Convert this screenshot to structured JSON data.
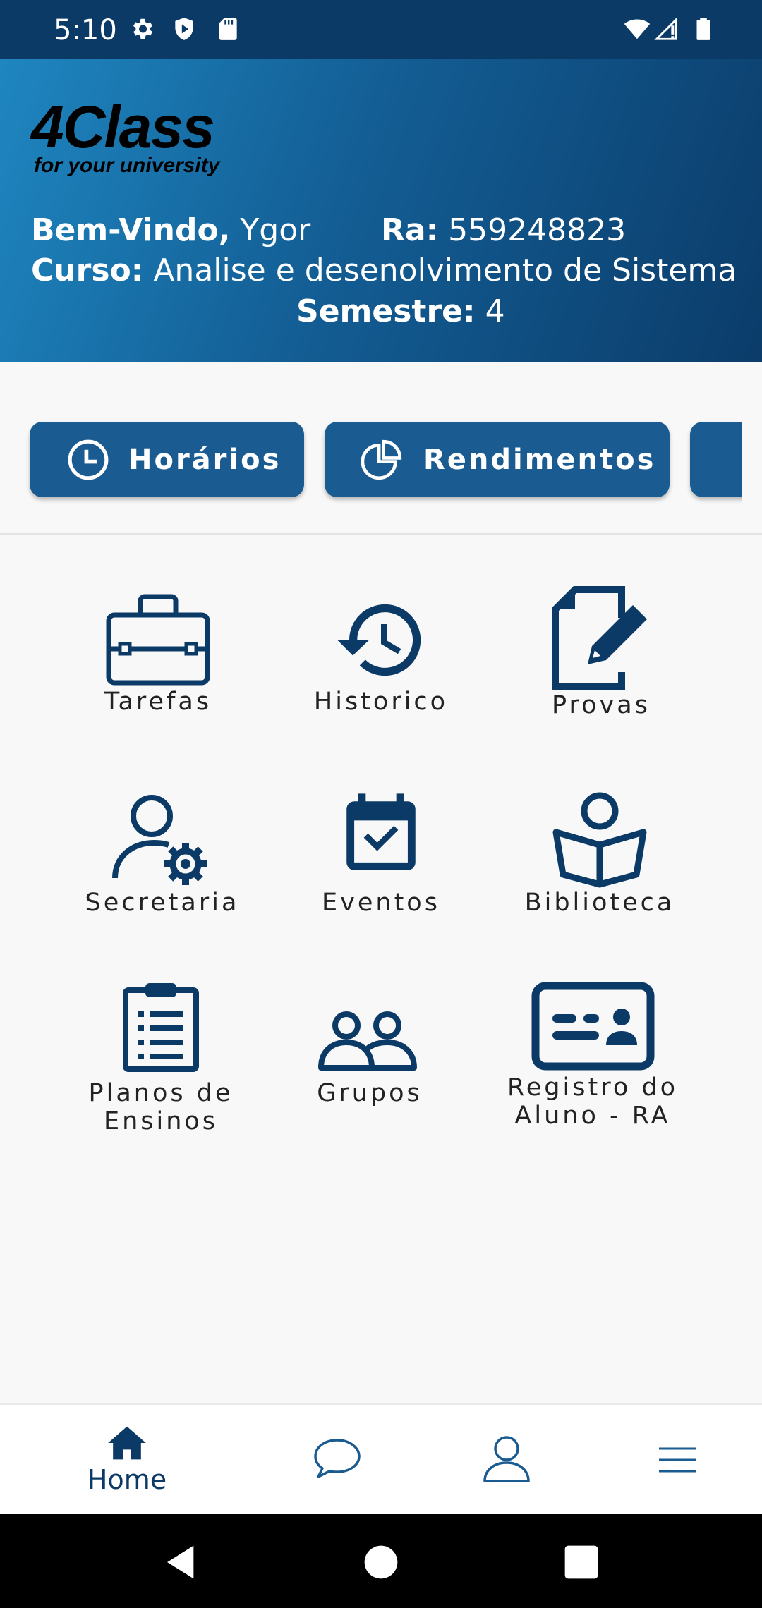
{
  "status_bar": {
    "time": "5:10",
    "icons": [
      "gear-icon",
      "shield-icon",
      "sd-card-icon",
      "wifi-icon",
      "signal-icon",
      "battery-icon"
    ]
  },
  "header": {
    "logo_main": "4Class",
    "logo_sub": "for your university",
    "welcome_label": "Bem-Vindo,",
    "welcome_name": "Ygor",
    "ra_label": "Ra:",
    "ra_value": "559248823",
    "curso_label": "Curso:",
    "curso_value": "Analise e desenolvimento de Sistema",
    "semestre_label": "Semestre:",
    "semestre_value": "4"
  },
  "quick_buttons": [
    {
      "label": "Horários",
      "icon": "clock-icon"
    },
    {
      "label": "Rendimentos",
      "icon": "pie-chart-icon"
    }
  ],
  "grid": [
    {
      "label": "Tarefas",
      "icon": "briefcase-icon"
    },
    {
      "label": "Historico",
      "icon": "history-icon"
    },
    {
      "label": "Provas",
      "icon": "edit-document-icon"
    },
    {
      "label": "Secretaria",
      "icon": "user-gear-icon"
    },
    {
      "label": "Eventos",
      "icon": "calendar-check-icon"
    },
    {
      "label": "Biblioteca",
      "icon": "reader-book-icon"
    },
    {
      "label_line1": "Planos de",
      "label_line2": "Ensinos",
      "icon": "clipboard-list-icon"
    },
    {
      "label": "Grupos",
      "icon": "group-icon"
    },
    {
      "label_line1": "Registro do",
      "label_line2": "Aluno - RA",
      "icon": "id-card-icon"
    }
  ],
  "bottom_nav": {
    "home_label": "Home",
    "items": [
      "home-icon",
      "chat-icon",
      "profile-icon",
      "menu-icon"
    ]
  },
  "colors": {
    "primary": "#0b3a66",
    "button": "#1a5b92",
    "header_gradient_start": "#1f86c0",
    "header_gradient_end": "#0b3c6a"
  }
}
